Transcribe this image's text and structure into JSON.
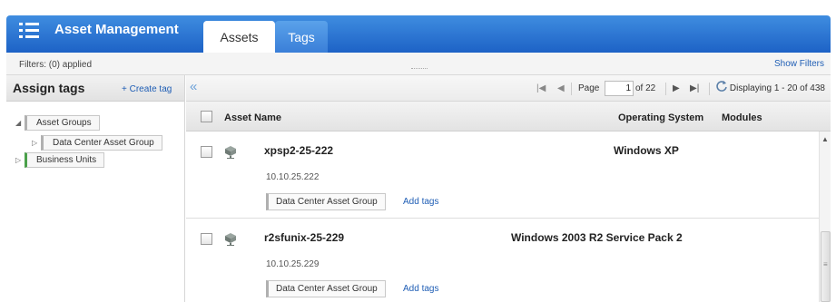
{
  "app": {
    "title": "Asset Management",
    "icon": "list-icon"
  },
  "tabs": [
    {
      "label": "Assets",
      "active": true
    },
    {
      "label": "Tags",
      "active": false
    }
  ],
  "filters": {
    "status": "Filters: (0) applied",
    "show_filters": "Show Filters"
  },
  "left_panel": {
    "title": "Assign tags",
    "create_tag": "+ Create tag",
    "tree": [
      {
        "label": "Asset Groups",
        "expanded": true,
        "color": "#b0b0b0"
      },
      {
        "label": "Data Center Asset Group",
        "expanded": false,
        "color": "#b0b0b0"
      },
      {
        "label": "Business Units",
        "expanded": false,
        "color": "#4aa04a"
      }
    ]
  },
  "pager": {
    "collapse": "«",
    "page_label": "Page",
    "page_value": "1",
    "page_of": "of 22",
    "displaying": "Displaying 1 - 20 of 438"
  },
  "grid": {
    "columns": {
      "name": "Asset Name",
      "os": "Operating System",
      "modules": "Modules"
    },
    "rows": [
      {
        "name": "xpsp2-25-222",
        "os": "Windows XP",
        "ip": "10.10.25.222",
        "tag": "Data Center Asset Group",
        "add_tags": "Add tags"
      },
      {
        "name": "r2sfunix-25-229",
        "os": "Windows 2003 R2 Service Pack 2",
        "ip": "10.10.25.229",
        "tag": "Data Center Asset Group",
        "add_tags": "Add tags"
      }
    ]
  },
  "colors": {
    "header": "#1d62c6",
    "link": "#1f5eb5",
    "tag_green": "#4aa04a"
  }
}
